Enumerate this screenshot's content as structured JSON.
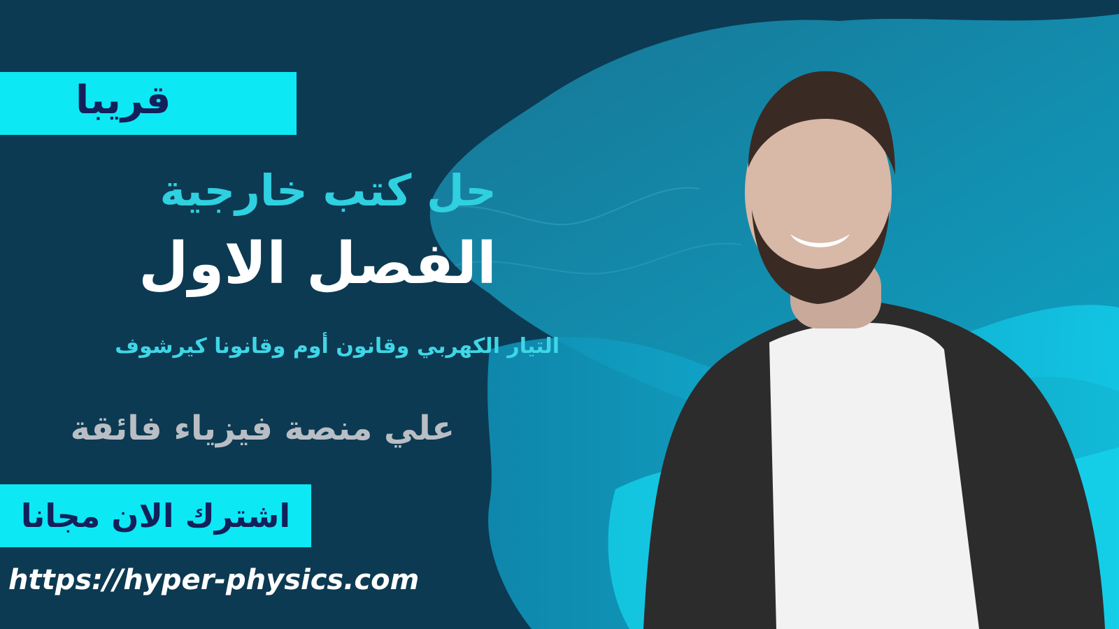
{
  "banner": {
    "badge_soon": "قريبا",
    "title_line1": "حل كتب خارجية",
    "title_line2": "الفصل الاول",
    "subtitle": "التيار الكهربي وقانون أوم وقانونا كيرشوف",
    "platform": "علي منصة فيزياء فائقة",
    "cta": "اشترك الان مجانا",
    "url": "https://hyper-physics.com"
  },
  "colors": {
    "background": "#0d3b55",
    "accent_cyan": "#0de8f5",
    "text_navy": "#13205a",
    "title_cyan": "#2fd0e0",
    "platform_gray": "#b9bec4"
  }
}
